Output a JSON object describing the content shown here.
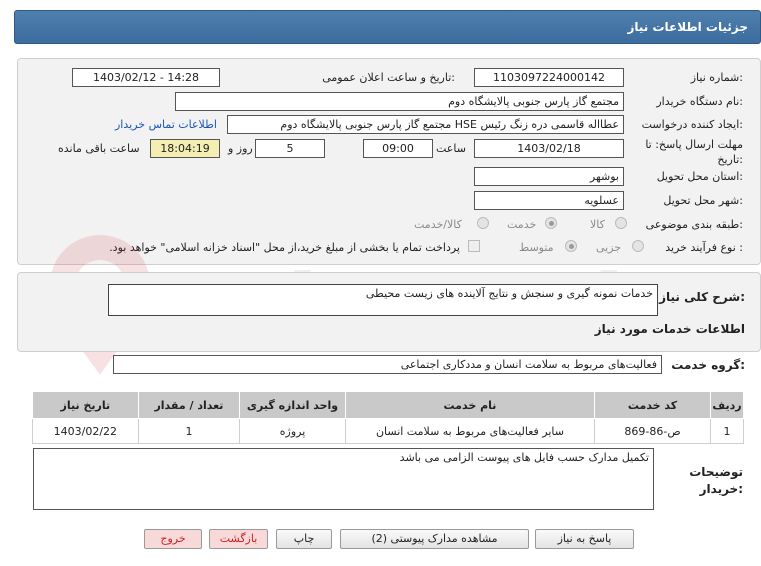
{
  "page": {
    "title": "جزئیات اطلاعات نیاز"
  },
  "info": {
    "need_number_label": "شماره نیاز:",
    "need_number": "1103097224000142",
    "announce_label": "تاریخ و ساعت اعلان عمومی:",
    "announce_value": "1403/02/12 - 14:28",
    "buyer_org_label": "نام دستگاه خریدار:",
    "buyer_org": "مجتمع گاز پارس جنوبی  پالایشگاه دوم",
    "requester_label": "ایجاد کننده درخواست:",
    "requester": "عطااله قاسمی دره زنگ رئیس HSE مجتمع گاز پارس جنوبی  پالایشگاه دوم",
    "contact_link": "اطلاعات تماس خریدار",
    "deadline_label": "مهلت ارسال پاسخ: تا تاریخ:",
    "deadline_date": "1403/02/18",
    "time_label": "ساعت",
    "deadline_time": "09:00",
    "days_value": "5",
    "days_label": "روز و",
    "remaining_time": "18:04:19",
    "remaining_label": "ساعت باقی مانده",
    "province_label": "استان محل تحویل:",
    "province": "بوشهر",
    "city_label": "شهر محل تحویل:",
    "city": "عسلویه",
    "category_label": "طبقه بندی موضوعی:",
    "category_options": [
      "کالا",
      "خدمت",
      "کالا/خدمت"
    ],
    "category_selected": "خدمت",
    "process_label": "نوع فرآیند خرید :",
    "process_options": [
      "جزیی",
      "متوسط"
    ],
    "process_selected": "متوسط",
    "payment_note": "پرداخت تمام یا بخشی از مبلغ خرید،از محل \"اسناد خزانه اسلامی\" خواهد بود."
  },
  "summary": {
    "label": "شرح کلی نیاز:",
    "text": "خدمات نمونه گیری و سنجش و نتایج آلاینده های زیست محیطی"
  },
  "services": {
    "section_title": "اطلاعات خدمات مورد نیاز",
    "group_label": "گروه خدمت:",
    "group_value": "فعالیت‌های مربوط به سلامت انسان و مددکاری اجتماعی",
    "columns": [
      "ردیف",
      "کد خدمت",
      "نام خدمت",
      "واحد اندازه گیری",
      "تعداد / مقدار",
      "تاریخ نیاز"
    ],
    "rows": [
      [
        "1",
        "ص-86-869",
        "سایر فعالیت‌های مربوط به سلامت انسان",
        "پروژه",
        "1",
        "1403/02/22"
      ]
    ]
  },
  "notes": {
    "label": "توضیحات خریدار:",
    "text": "تکمیل مدارک حسب فایل های پیوست الزامی می باشد"
  },
  "buttons": {
    "reply": "پاسخ به نیاز",
    "attachments": "مشاهده مدارک پیوستی (2)",
    "print": "چاپ",
    "back": "بازگشت",
    "exit": "خروج"
  },
  "watermark": {
    "text": "AriaTender.net"
  },
  "colors": {
    "header_bg": "#3c6d9e",
    "link": "#1a56b8",
    "remaining_bg": "#f4eeb3"
  }
}
